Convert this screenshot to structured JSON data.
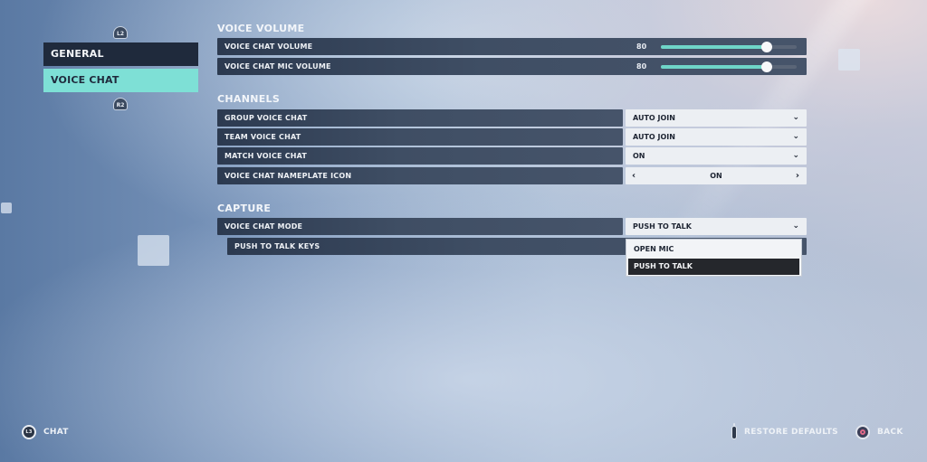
{
  "sidebar": {
    "bumper_top": "L2",
    "bumper_bottom": "R2",
    "tabs": [
      {
        "label": "GENERAL",
        "active": false
      },
      {
        "label": "VOICE CHAT",
        "active": true
      }
    ]
  },
  "sections": {
    "voice_volume": {
      "title": "VOICE VOLUME",
      "rows": [
        {
          "label": "VOICE CHAT VOLUME",
          "value": "80",
          "fraction": 0.78
        },
        {
          "label": "VOICE CHAT MIC VOLUME",
          "value": "80",
          "fraction": 0.78
        }
      ]
    },
    "channels": {
      "title": "CHANNELS",
      "rows": [
        {
          "label": "GROUP VOICE CHAT",
          "value": "AUTO JOIN",
          "control": "dropdown"
        },
        {
          "label": "TEAM VOICE CHAT",
          "value": "AUTO JOIN",
          "control": "dropdown"
        },
        {
          "label": "MATCH VOICE CHAT",
          "value": "ON",
          "control": "dropdown"
        },
        {
          "label": "VOICE CHAT NAMEPLATE ICON",
          "value": "ON",
          "control": "arrows"
        }
      ]
    },
    "capture": {
      "title": "CAPTURE",
      "rows": [
        {
          "label": "VOICE CHAT MODE",
          "value": "PUSH TO TALK",
          "control": "dropdown"
        },
        {
          "label": "PUSH TO TALK KEYS"
        }
      ],
      "dropdown_options": [
        "OPEN MIC",
        "PUSH TO TALK"
      ],
      "dropdown_selected": "PUSH TO TALK"
    }
  },
  "icons": {
    "chevron_down": "⌄",
    "arrow_left": "‹",
    "arrow_right": "›"
  },
  "footer": {
    "chat_button_glyph": "L3",
    "chat_label": "CHAT",
    "restore_label": "RESTORE DEFAULTS",
    "back_label": "BACK"
  },
  "colors": {
    "accent": "#7ee0d6",
    "slider_fill": "#6fd5c8",
    "row_bg": "#2c3a50",
    "active_tab_text": "#1f2a3c"
  }
}
